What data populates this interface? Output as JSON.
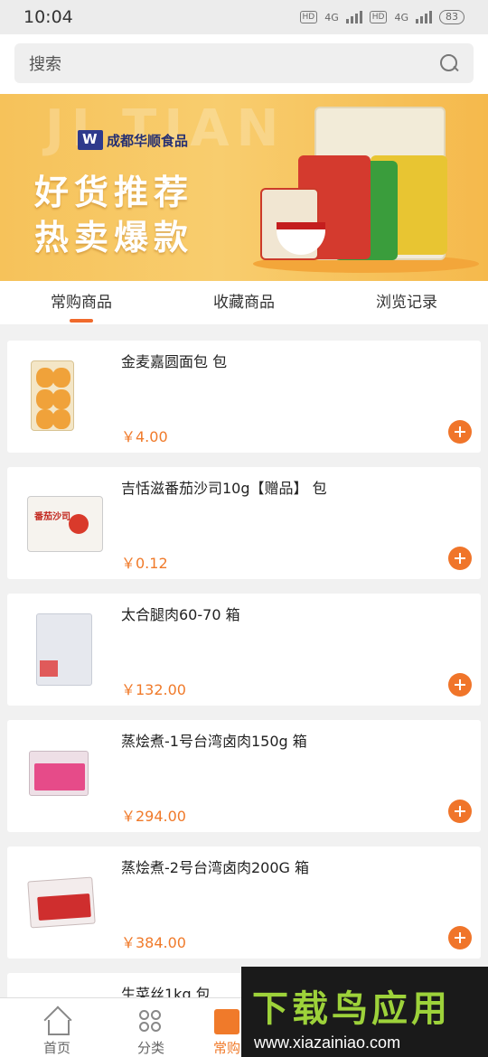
{
  "status_bar": {
    "time": "10:04",
    "hd1": "HD",
    "net1": "4G",
    "hd2": "HD",
    "net2": "4G",
    "battery": "83"
  },
  "search": {
    "placeholder": "搜索",
    "icon": "search-icon"
  },
  "banner": {
    "watermark": "JI TIAN",
    "brand": "成都华顺食品",
    "line1": "好货推荐",
    "line2": "热卖爆款"
  },
  "tabs": [
    {
      "label": "常购商品",
      "active": true
    },
    {
      "label": "收藏商品",
      "active": false
    },
    {
      "label": "浏览记录",
      "active": false
    }
  ],
  "products": [
    {
      "title": "金麦嘉圆面包 包",
      "price": "￥4.00"
    },
    {
      "title": "吉恬滋番茄沙司10g【赠品】 包",
      "price": "￥0.12",
      "thumb_label": "番茄沙司"
    },
    {
      "title": "太合腿肉60-70 箱",
      "price": "￥132.00"
    },
    {
      "title": "蒸烩煮-1号台湾卤肉150g 箱",
      "price": "￥294.00"
    },
    {
      "title": "蒸烩煮-2号台湾卤肉200G 箱",
      "price": "￥384.00"
    },
    {
      "title": "生菜丝1kg 包",
      "price": ""
    }
  ],
  "bottom_nav": [
    {
      "label": "首页",
      "icon": "home-icon"
    },
    {
      "label": "分类",
      "icon": "category-icon"
    },
    {
      "label": "常购",
      "icon": "order-icon",
      "active": true
    }
  ],
  "watermark": {
    "title": "下载鸟应用",
    "url": "www.xiazainiao.com"
  },
  "colors": {
    "accent": "#f07a2a",
    "banner": "#f6c25a"
  }
}
